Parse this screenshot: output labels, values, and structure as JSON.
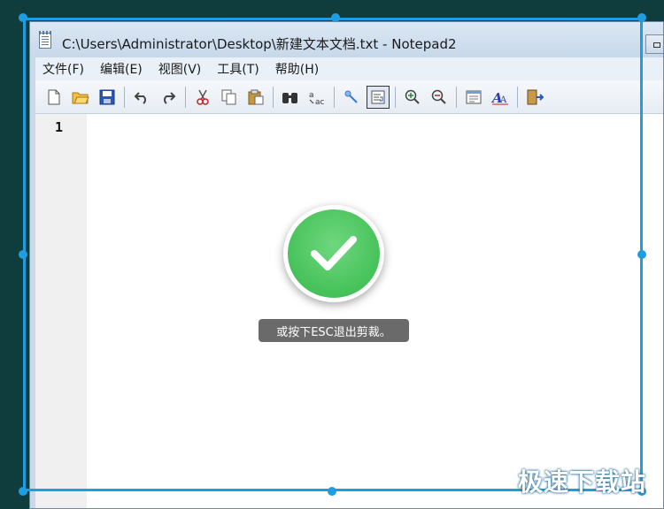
{
  "window": {
    "title": "C:\\Users\\Administrator\\Desktop\\新建文本文档.txt - Notepad2"
  },
  "menu": {
    "items": [
      {
        "label": "文件(F)"
      },
      {
        "label": "编辑(E)"
      },
      {
        "label": "视图(V)"
      },
      {
        "label": "工具(T)"
      },
      {
        "label": "帮助(H)"
      }
    ]
  },
  "toolbar": {
    "icons": [
      "new-file-icon",
      "open-folder-icon",
      "save-icon",
      "undo-icon",
      "redo-icon",
      "cut-icon",
      "copy-icon",
      "paste-icon",
      "find-icon",
      "replace-icon",
      "wrap-icon",
      "view-wordwrap-icon",
      "zoom-in-icon",
      "zoom-out-icon",
      "settings-icon",
      "font-icon",
      "exit-icon"
    ]
  },
  "editor": {
    "line_number": "1"
  },
  "capture": {
    "toast": "或按下ESC退出剪裁。",
    "accent_color": "#1e9de3",
    "success_color": "#43c057"
  },
  "watermark": {
    "text": "极速下载站"
  }
}
